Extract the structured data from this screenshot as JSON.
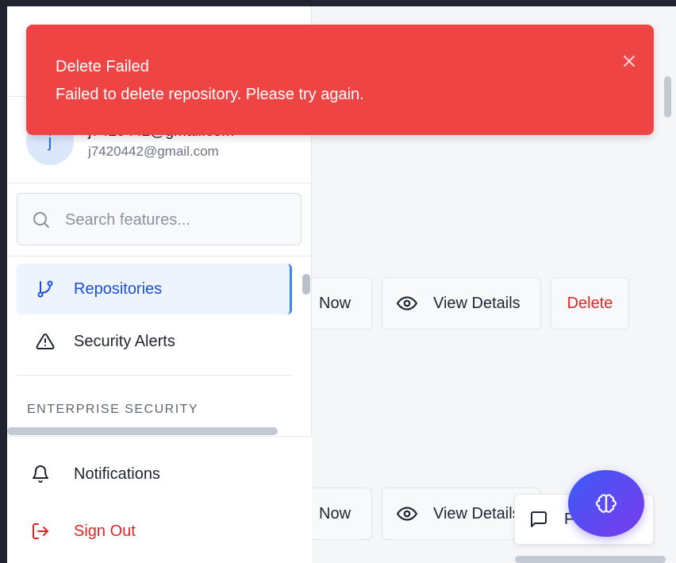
{
  "toast": {
    "title": "Delete Failed",
    "message": "Failed to delete repository. Please try again.",
    "color": "#ef4444"
  },
  "user": {
    "avatar_initial": "j",
    "display_name": "j7420442@gmail.com",
    "email": "j7420442@gmail.com"
  },
  "search": {
    "placeholder": "Search features..."
  },
  "nav": {
    "items": [
      {
        "label": "Repositories",
        "icon": "git-branch-icon",
        "active": true
      },
      {
        "label": "Security Alerts",
        "icon": "alert-triangle-icon",
        "active": false
      }
    ],
    "section_header": "ENTERPRISE SECURITY"
  },
  "bottom_nav": {
    "notifications": "Notifications",
    "sign_out": "Sign Out"
  },
  "repo_rows": [
    {
      "scan_label": "Now",
      "view_label": "View Details",
      "delete_label": "Delete"
    },
    {
      "scan_label": "Now",
      "view_label": "View Details"
    }
  ],
  "feedback": {
    "label": "Feedback"
  },
  "colors": {
    "accent": "#2563eb",
    "danger": "#dc2626",
    "fab_gradient_start": "#3b5bf5",
    "fab_gradient_end": "#7c3aed"
  }
}
